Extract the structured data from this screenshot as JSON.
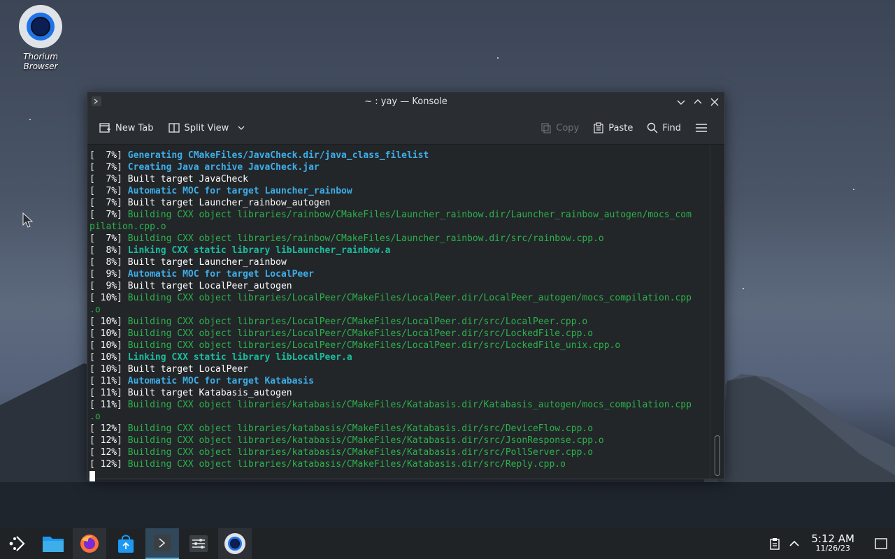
{
  "desktop": {
    "icon_label": "Thorium Browser"
  },
  "window": {
    "title": "~ : yay — Konsole",
    "toolbar": {
      "new_tab": "New Tab",
      "split_view": "Split View",
      "copy": "Copy",
      "paste": "Paste",
      "find": "Find"
    }
  },
  "terminal": {
    "lines": [
      {
        "prefix": "[  7%] ",
        "text": "Generating CMakeFiles/JavaCheck.dir/java_class_filelist",
        "style": "blue"
      },
      {
        "prefix": "[  7%] ",
        "text": "Creating Java archive JavaCheck.jar",
        "style": "blue"
      },
      {
        "prefix": "[  7%] ",
        "text": "Built target JavaCheck",
        "style": "plain"
      },
      {
        "prefix": "[  7%] ",
        "text": "Automatic MOC for target Launcher_rainbow",
        "style": "blue"
      },
      {
        "prefix": "[  7%] ",
        "text": "Built target Launcher_rainbow_autogen",
        "style": "plain"
      },
      {
        "prefix": "[  7%] ",
        "text": "Building CXX object libraries/rainbow/CMakeFiles/Launcher_rainbow.dir/Launcher_rainbow_autogen/mocs_com",
        "style": "green"
      },
      {
        "prefix": "",
        "text": "pilation.cpp.o",
        "style": "green"
      },
      {
        "prefix": "[  7%] ",
        "text": "Building CXX object libraries/rainbow/CMakeFiles/Launcher_rainbow.dir/src/rainbow.cpp.o",
        "style": "green"
      },
      {
        "prefix": "[  8%] ",
        "text": "Linking CXX static library libLauncher_rainbow.a",
        "style": "teal"
      },
      {
        "prefix": "[  8%] ",
        "text": "Built target Launcher_rainbow",
        "style": "plain"
      },
      {
        "prefix": "[  9%] ",
        "text": "Automatic MOC for target LocalPeer",
        "style": "blue"
      },
      {
        "prefix": "[  9%] ",
        "text": "Built target LocalPeer_autogen",
        "style": "plain"
      },
      {
        "prefix": "[ 10%] ",
        "text": "Building CXX object libraries/LocalPeer/CMakeFiles/LocalPeer.dir/LocalPeer_autogen/mocs_compilation.cpp",
        "style": "green"
      },
      {
        "prefix": "",
        "text": ".o",
        "style": "green"
      },
      {
        "prefix": "[ 10%] ",
        "text": "Building CXX object libraries/LocalPeer/CMakeFiles/LocalPeer.dir/src/LocalPeer.cpp.o",
        "style": "green"
      },
      {
        "prefix": "[ 10%] ",
        "text": "Building CXX object libraries/LocalPeer/CMakeFiles/LocalPeer.dir/src/LockedFile.cpp.o",
        "style": "green"
      },
      {
        "prefix": "[ 10%] ",
        "text": "Building CXX object libraries/LocalPeer/CMakeFiles/LocalPeer.dir/src/LockedFile_unix.cpp.o",
        "style": "green"
      },
      {
        "prefix": "[ 10%] ",
        "text": "Linking CXX static library libLocalPeer.a",
        "style": "teal"
      },
      {
        "prefix": "[ 10%] ",
        "text": "Built target LocalPeer",
        "style": "plain"
      },
      {
        "prefix": "[ 11%] ",
        "text": "Automatic MOC for target Katabasis",
        "style": "blue"
      },
      {
        "prefix": "[ 11%] ",
        "text": "Built target Katabasis_autogen",
        "style": "plain"
      },
      {
        "prefix": "[ 11%] ",
        "text": "Building CXX object libraries/katabasis/CMakeFiles/Katabasis.dir/Katabasis_autogen/mocs_compilation.cpp",
        "style": "green"
      },
      {
        "prefix": "",
        "text": ".o",
        "style": "green"
      },
      {
        "prefix": "[ 12%] ",
        "text": "Building CXX object libraries/katabasis/CMakeFiles/Katabasis.dir/src/DeviceFlow.cpp.o",
        "style": "green"
      },
      {
        "prefix": "[ 12%] ",
        "text": "Building CXX object libraries/katabasis/CMakeFiles/Katabasis.dir/src/JsonResponse.cpp.o",
        "style": "green"
      },
      {
        "prefix": "[ 12%] ",
        "text": "Building CXX object libraries/katabasis/CMakeFiles/Katabasis.dir/src/PollServer.cpp.o",
        "style": "green"
      },
      {
        "prefix": "[ 12%] ",
        "text": "Building CXX object libraries/katabasis/CMakeFiles/Katabasis.dir/src/Reply.cpp.o",
        "style": "green"
      }
    ]
  },
  "taskbar": {
    "time": "5:12 AM",
    "date": "11/26/23"
  }
}
